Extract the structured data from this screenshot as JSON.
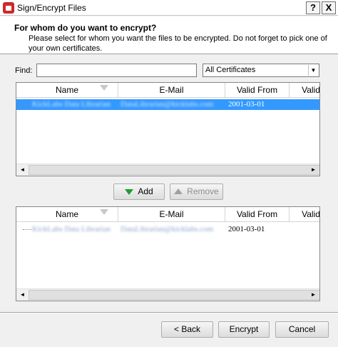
{
  "window": {
    "title": "Sign/Encrypt Files",
    "help_label": "?",
    "close_label": "X"
  },
  "header": {
    "title": "For whom do you want to encrypt?",
    "description": "Please select for whom you want the files to be encrypted. Do not forget to pick one of your own certificates."
  },
  "find": {
    "label": "Find:",
    "value": ""
  },
  "filter": {
    "selected": "All Certificates"
  },
  "columns": {
    "name": "Name",
    "email": "E-Mail",
    "valid_from": "Valid From",
    "valid_to": "Valid"
  },
  "available": {
    "rows": [
      {
        "name": "KickLabs Data Librarian",
        "email": "DataLibrarian@kicklabs.com",
        "valid_from": "2001-03-01",
        "selected": true
      }
    ]
  },
  "actions": {
    "add_label": "Add",
    "remove_label": "Remove"
  },
  "recipients": {
    "rows": [
      {
        "name": "KickLabs Data Librarian",
        "email": "DataLibrarian@kicklabs.com",
        "valid_from": "2001-03-01"
      }
    ]
  },
  "footer": {
    "back_label": "< Back",
    "encrypt_label": "Encrypt",
    "cancel_label": "Cancel"
  },
  "colors": {
    "selection": "#3399ff",
    "add_arrow": "#1f9e2f"
  }
}
